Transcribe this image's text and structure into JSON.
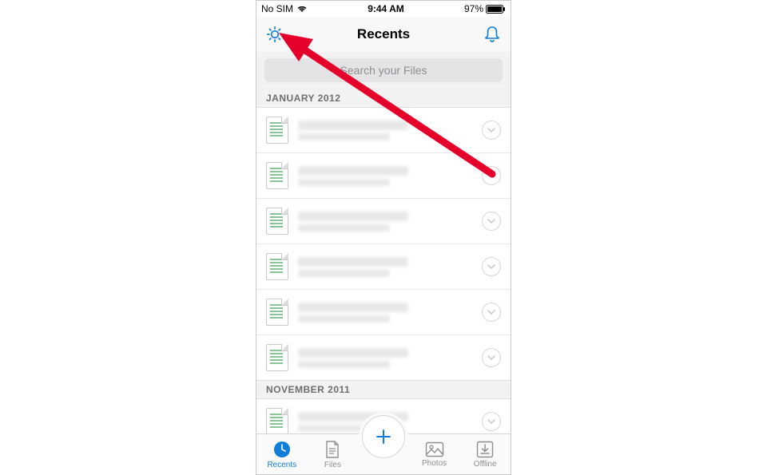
{
  "statusbar": {
    "carrier": "No SIM",
    "time": "9:44 AM",
    "battery_pct": "97%"
  },
  "nav": {
    "title": "Recents"
  },
  "search": {
    "placeholder": "Search your Files"
  },
  "sections": [
    {
      "label": "JANUARY 2012",
      "rows": 6
    },
    {
      "label": "NOVEMBER 2011",
      "rows": 1
    }
  ],
  "tabs": {
    "recents": "Recents",
    "files": "Files",
    "photos": "Photos",
    "offline": "Offline"
  }
}
